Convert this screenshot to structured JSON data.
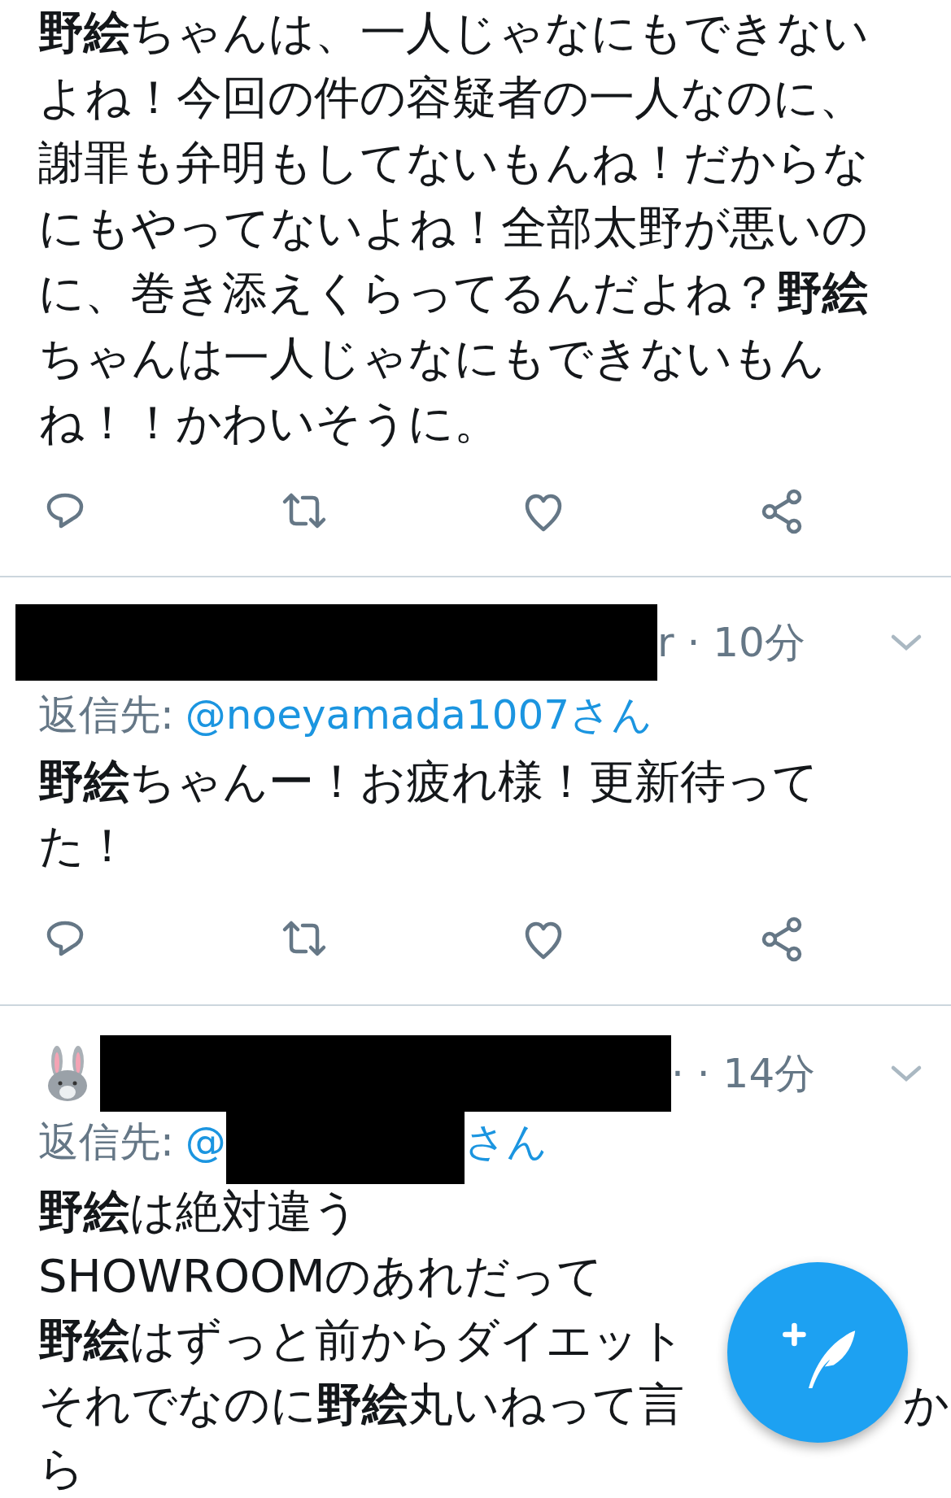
{
  "tweets": [
    {
      "lines": [
        {
          "text": "**野絵**ちゃんは、一人じゃなにもできない"
        },
        {
          "text": "よね！今回の件の容疑者の一人なのに、"
        },
        {
          "text": "謝罪も弁明もしてないもんね！だからな"
        },
        {
          "text": "にもやってないよね！全部太野が悪いの"
        },
        {
          "text": "に、巻き添えくらってるんだよね？**野絵**"
        },
        {
          "text": "ちゃんは一人じゃなにもできないもん"
        },
        {
          "text": "ね！！かわいそうに。"
        }
      ]
    },
    {
      "header": {
        "redacted": true,
        "meta": "r · 10分"
      },
      "reply": {
        "label": "返信先:",
        "handle": "@noeyamada1007さん"
      },
      "lines": [
        {
          "text": "**野絵**ちゃんー！お疲れ様！更新待って"
        },
        {
          "text": "た！"
        }
      ]
    },
    {
      "header": {
        "redacted": true,
        "avatar": true,
        "meta": "· · 14分"
      },
      "reply": {
        "label": "返信先:",
        "handle": "@",
        "redacted": true,
        "suffix": "さん"
      },
      "lines": [
        {
          "text": "**野絵**は絶対違う"
        },
        {
          "text": "SHOWROOMのあれだって"
        },
        {
          "text": "**野絵**はずっと前からダイエット"
        },
        {
          "text": "それでなのに**野絵**丸いねって言",
          "tail": "か"
        },
        {
          "text": "ら"
        }
      ]
    }
  ]
}
